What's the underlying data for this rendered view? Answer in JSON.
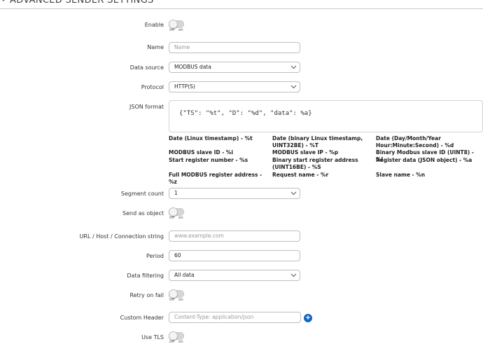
{
  "section": {
    "title": "ADVANCED SENDER SETTINGS"
  },
  "toggle_labels": {
    "off": "off",
    "on": "on"
  },
  "fields": {
    "enable": {
      "label": "Enable"
    },
    "name": {
      "label": "Name",
      "placeholder": "Name"
    },
    "data_source": {
      "label": "Data source",
      "value": "MODBUS data"
    },
    "protocol": {
      "label": "Protocol",
      "value": "HTTP(S)"
    },
    "json_format": {
      "label": "JSON format",
      "value": "{\"TS\": \"%t\", \"D\": \"%d\", \"data\": %a}"
    },
    "segment_count": {
      "label": "Segment count",
      "value": "1"
    },
    "send_as_object": {
      "label": "Send as object"
    },
    "url": {
      "label": "URL / Host / Connection string",
      "placeholder": "www.example.com"
    },
    "period": {
      "label": "Period",
      "value": "60"
    },
    "data_filtering": {
      "label": "Data filtering",
      "value": "All data"
    },
    "retry_on_fail": {
      "label": "Retry on fail"
    },
    "custom_header": {
      "label": "Custom Header",
      "placeholder": "Content-Type: application/json"
    },
    "use_tls": {
      "label": "Use TLS"
    }
  },
  "format_hints": {
    "col1": [
      "Date (Linux timestamp) - %t",
      "MODBUS slave ID - %i",
      "Start register number - %s",
      "Full MODBUS register address - %z"
    ],
    "col2": [
      "Date (binary Linux timestamp, UINT32BE) - %T",
      "MODBUS slave IP - %p",
      "Binary start register address (UINT16BE) - %S",
      "Request name - %r"
    ],
    "col3": [
      "Date (Day/Month/Year Hour:Minute:Second) - %d",
      "Binary Modbus slave ID (UINT8) - %I",
      "Register data (JSON object) - %a",
      "Slave name - %n"
    ]
  },
  "icons": {
    "add": "plus-circle-icon",
    "dropdown": "chevron-down-icon",
    "section": "chevron-down-icon"
  },
  "colors": {
    "accent": "#1565c0",
    "toggle_off": "#d6d6d6"
  }
}
